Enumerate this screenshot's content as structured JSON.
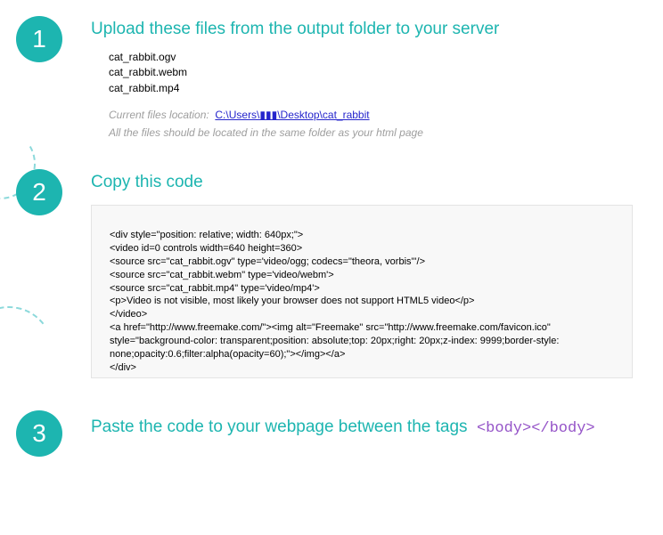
{
  "step1": {
    "num": "1",
    "heading": "Upload these files from the output folder to your server",
    "files": [
      "cat_rabbit.ogv",
      "cat_rabbit.webm",
      "cat_rabbit.mp4"
    ],
    "location_label": "Current files location:",
    "location_path": "C:\\Users\\▮▮▮\\Desktop\\cat_rabbit",
    "note": "All the files should be located in the same folder as your html page"
  },
  "step2": {
    "num": "2",
    "heading": "Copy this code",
    "code": "<div style=\"position: relative; width: 640px;\">\n<video id=0 controls width=640 height=360>\n<source src=\"cat_rabbit.ogv\" type='video/ogg; codecs=\"theora, vorbis\"'/>\n<source src=\"cat_rabbit.webm\" type='video/webm'>\n<source src=\"cat_rabbit.mp4\" type='video/mp4'>\n<p>Video is not visible, most likely your browser does not support HTML5 video</p>\n</video>\n<a href=\"http://www.freemake.com/\"><img alt=\"Freemake\" src=\"http://www.freemake.com/favicon.ico\" style=\"background-color: transparent;position: absolute;top: 20px;right: 20px;z-index: 9999;border-style: none;opacity:0.6;filter:alpha(opacity=60);\"></img></a>\n</div>"
  },
  "step3": {
    "num": "3",
    "heading": "Paste the code to your webpage between the tags",
    "tags": "<body></body>"
  }
}
